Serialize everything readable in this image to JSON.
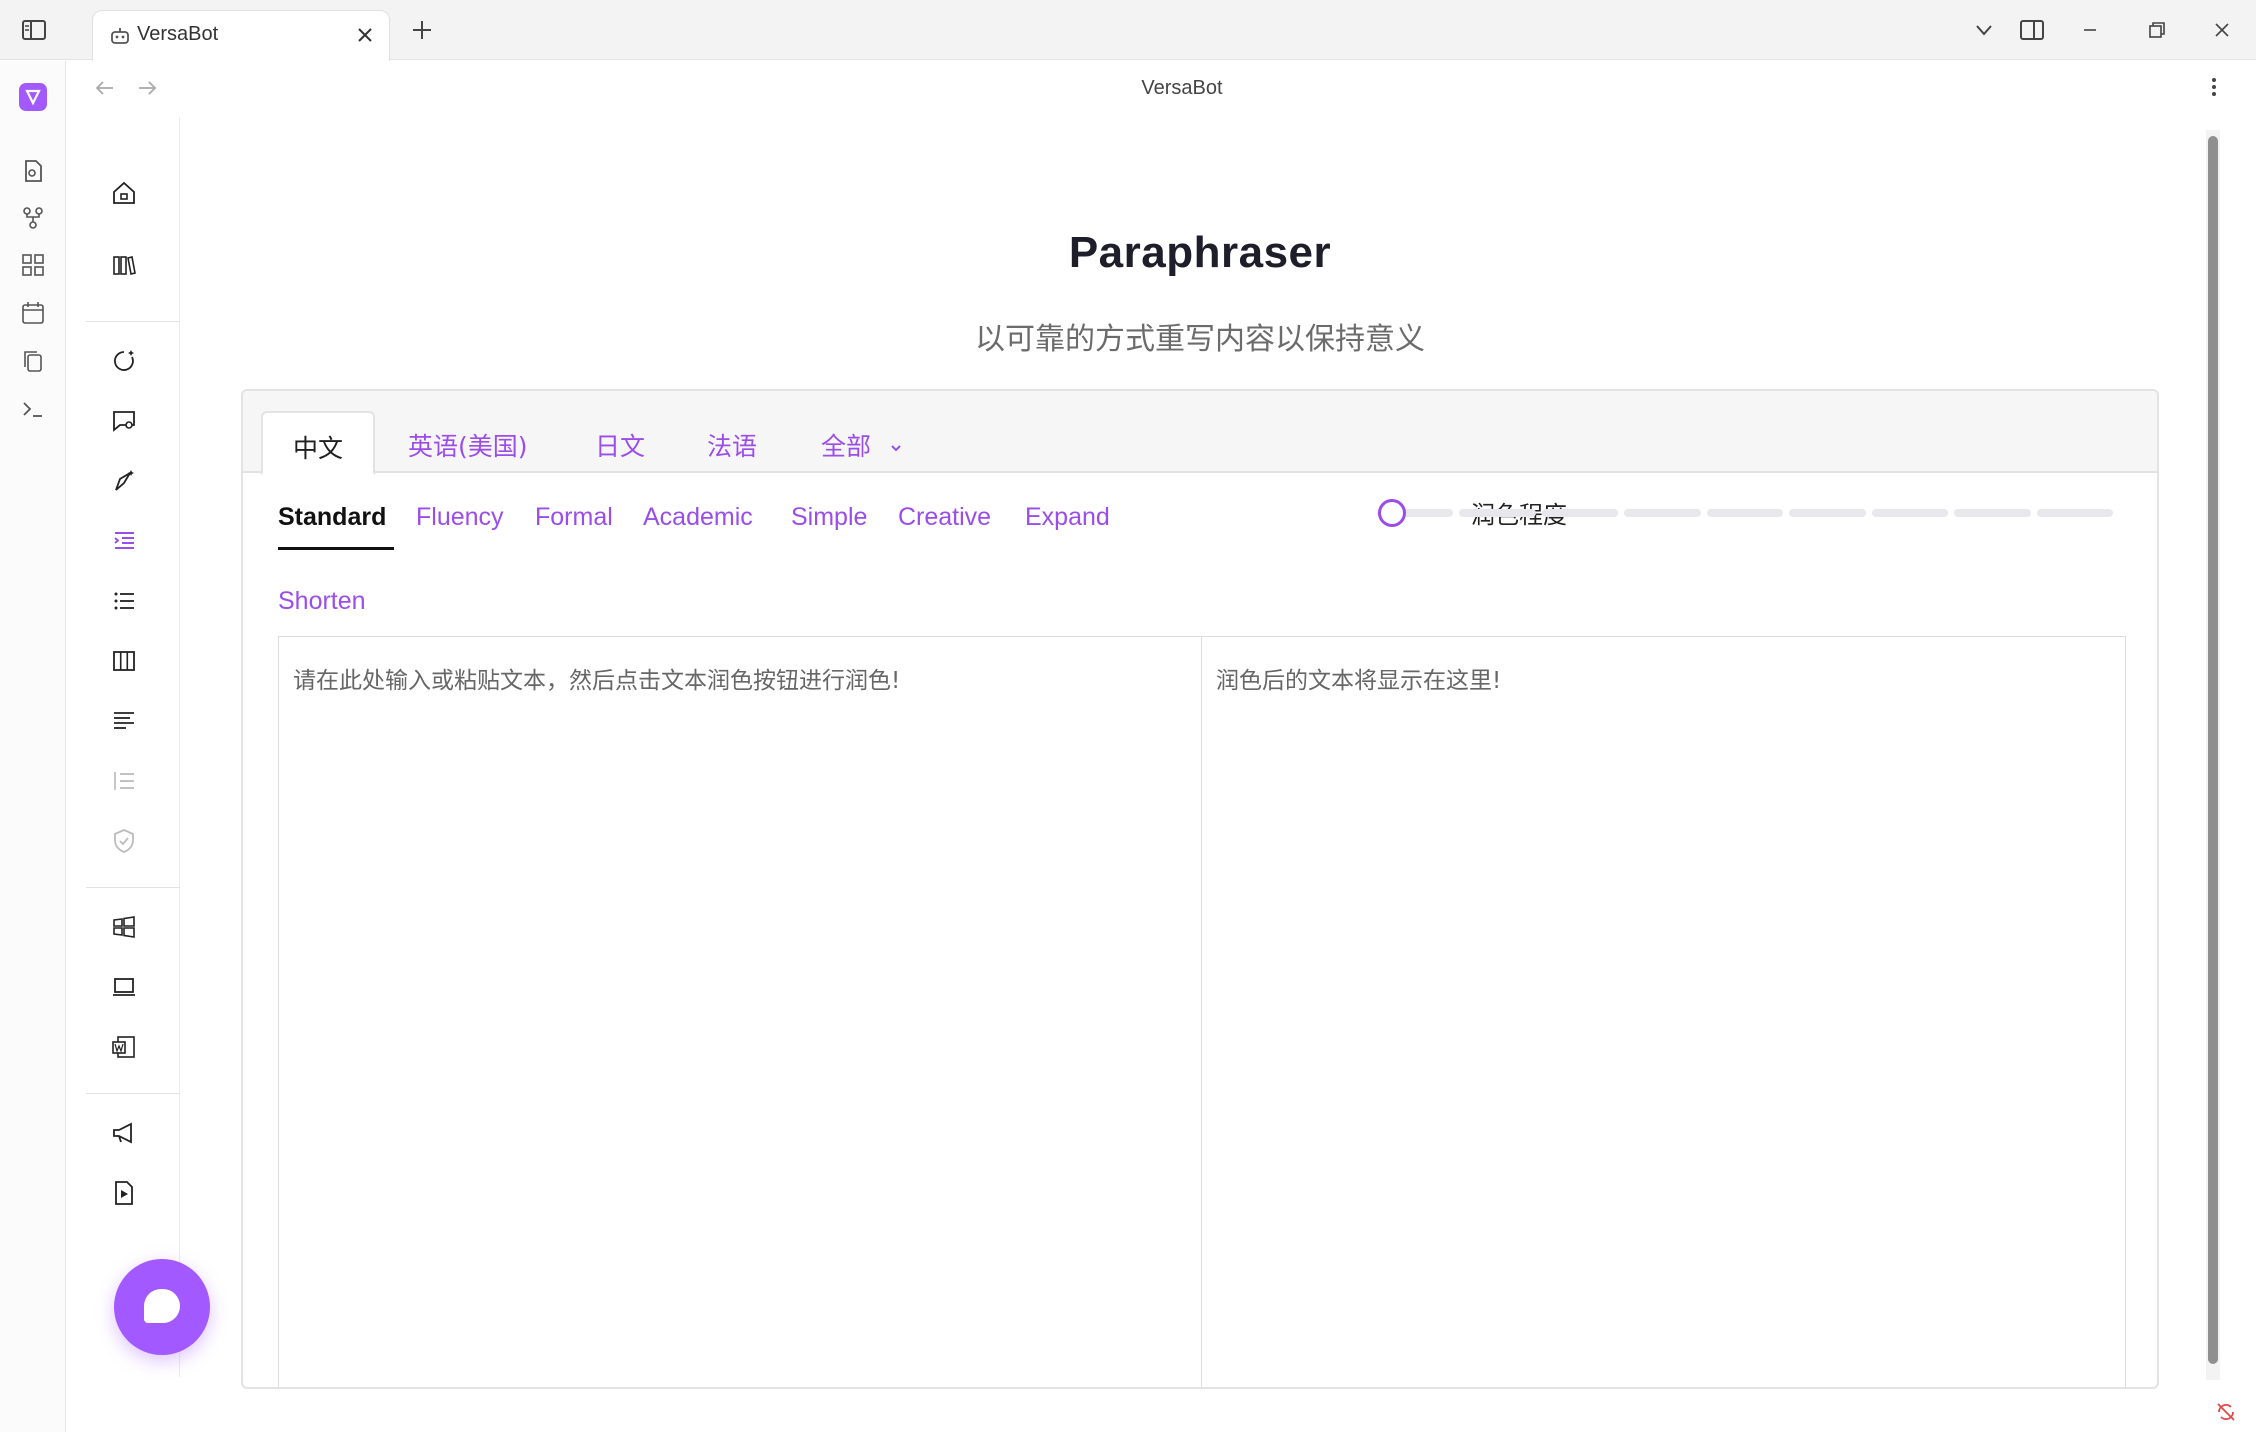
{
  "browser": {
    "tab_title": "VersaBot",
    "page_title": "VersaBot"
  },
  "main": {
    "title": "Paraphraser",
    "subtitle": "以可靠的方式重写内容以保持意义"
  },
  "languages": {
    "tabs": [
      {
        "label": "中文",
        "active": true
      },
      {
        "label": "英语(美国)",
        "active": false
      },
      {
        "label": "日文",
        "active": false
      },
      {
        "label": "法语",
        "active": false
      },
      {
        "label": "全部",
        "active": false
      }
    ]
  },
  "modes": {
    "items": [
      "Standard",
      "Fluency",
      "Formal",
      "Academic",
      "Simple",
      "Creative",
      "Expand",
      "Shorten"
    ],
    "active": "Standard"
  },
  "degree": {
    "label": "润色程度",
    "segments": 9,
    "value_index": 0
  },
  "editor": {
    "input_placeholder": "请在此处输入或粘贴文本，然后点击文本润色按钮进行润色!",
    "output_placeholder": "润色后的文本将显示在这里!"
  },
  "colors": {
    "accent": "#a259ff",
    "link": "#9b4dea"
  }
}
